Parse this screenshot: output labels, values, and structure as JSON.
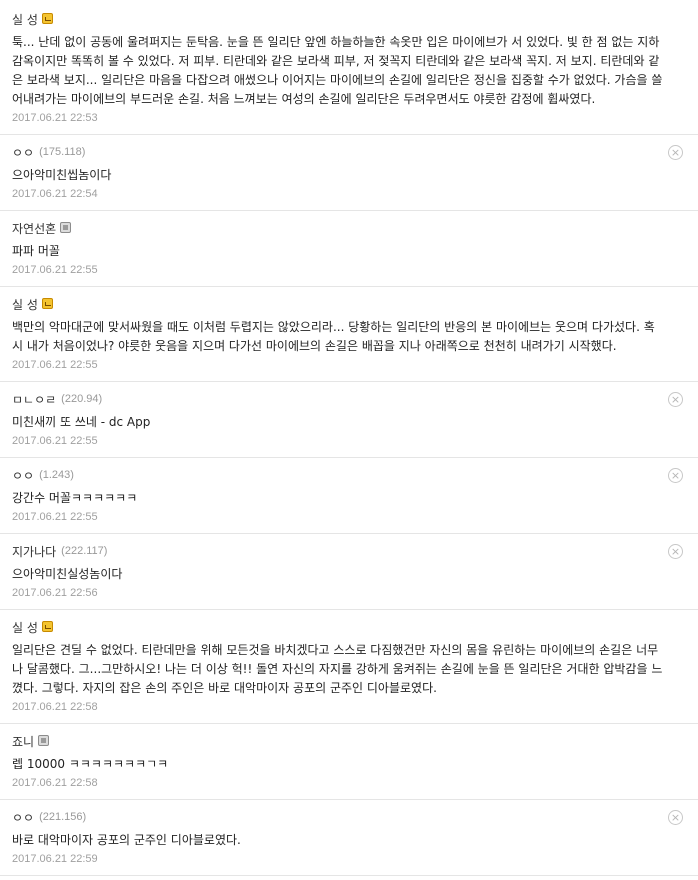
{
  "comments": [
    {
      "author": "실 성",
      "badge": "fixed",
      "ip": "",
      "text": "툭... 난데 없이 공동에 울려퍼지는 둔탁음. 눈을 뜬 일리단 앞엔 하늘하늘한 속옷만 입은 마이에브가 서 있었다. 빛 한 점 없는 지하감옥이지만 똑똑히 볼 수 있었다. 저 피부. 티란데와 같은 보라색 피부, 저 젖꼭지 티란데와 같은 보라색 꼭지. 저 보지. 티란데와 같은 보라색 보지... 일리단은 마음을 다잡으려 애썼으나 이어지는 마이에브의 손길에 일리단은 정신을 집중할 수가 없었다. 가슴을 쓸어내려가는 마이에브의 부드러운 손길. 처음 느껴보는 여성의 손길에 일리단은 두려우면서도 야릇한 감정에 휩싸였다.",
      "date": "2017.06.21 22:53",
      "deletable": false
    },
    {
      "author": "ㅇㅇ",
      "badge": "",
      "ip": "(175.118)",
      "text": "으아악미친씹놈이다",
      "date": "2017.06.21 22:54",
      "deletable": true
    },
    {
      "author": "자연선혼",
      "badge": "half",
      "ip": "",
      "text": "파파 머꼴",
      "date": "2017.06.21 22:55",
      "deletable": false
    },
    {
      "author": "실 성",
      "badge": "fixed",
      "ip": "",
      "text": "백만의 악마대군에 맞서싸웠을 때도 이처럼 두렵지는 않았으리라... 당황하는 일리단의 반응의 본 마이에브는 웃으며 다가섰다. 혹시 내가 처음이었나? 야릇한 웃음을 지으며 다가선 마이에브의 손길은 배꼽을 지나 아래쪽으로 천천히 내려가기 시작했다.",
      "date": "2017.06.21 22:55",
      "deletable": false
    },
    {
      "author": "ㅁㄴㅇㄹ",
      "badge": "",
      "ip": "(220.94)",
      "text": "미친새끼 또 쓰네 - dc App",
      "date": "2017.06.21 22:55",
      "deletable": true
    },
    {
      "author": "ㅇㅇ",
      "badge": "",
      "ip": "(1.243)",
      "text": "강간수 머꼴ㅋㅋㅋㅋㅋㅋ",
      "date": "2017.06.21 22:55",
      "deletable": true
    },
    {
      "author": "지가나다",
      "badge": "",
      "ip": "(222.117)",
      "text": "으아악미친실성놈이다",
      "date": "2017.06.21 22:56",
      "deletable": true
    },
    {
      "author": "실 성",
      "badge": "fixed",
      "ip": "",
      "text": "일리단은 견딜 수 없었다. 티란데만을 위해 모든것을 바치겠다고 스스로 다짐했건만 자신의 몸을 유린하는 마이에브의 손길은 너무나 달콤했다. 그...그만하시오! 나는 더 이상 헉!! 돌연 자신의 자지를 강하게 움켜쥐는 손길에 눈을 뜬 일리단은 거대한 압박감을 느꼈다. 그렇다. 자지의 잡은 손의 주인은 바로 대악마이자 공포의 군주인 디아블로였다.",
      "date": "2017.06.21 22:58",
      "deletable": false
    },
    {
      "author": "죠니",
      "badge": "half",
      "ip": "",
      "text": "렙 10000 ㅋㅋㅋㅋㅋㅋㅋㄱㅋ",
      "date": "2017.06.21 22:58",
      "deletable": false
    },
    {
      "author": "ㅇㅇ",
      "badge": "",
      "ip": "(221.156)",
      "text": "바로 대악마이자 공포의 군주인 디아블로였다.",
      "date": "2017.06.21 22:59",
      "deletable": true
    }
  ],
  "icons": {
    "delete": "close-circle-icon",
    "fixed_badge": "gallog-fixed-nick-icon",
    "half_badge": "gallog-half-fixed-nick-icon"
  },
  "colors": {
    "ip": "#999999",
    "date": "#a0a0a0",
    "divider": "#e5e5e5",
    "fixed_badge": "#f4c430",
    "half_badge": "#dcdcdc"
  }
}
